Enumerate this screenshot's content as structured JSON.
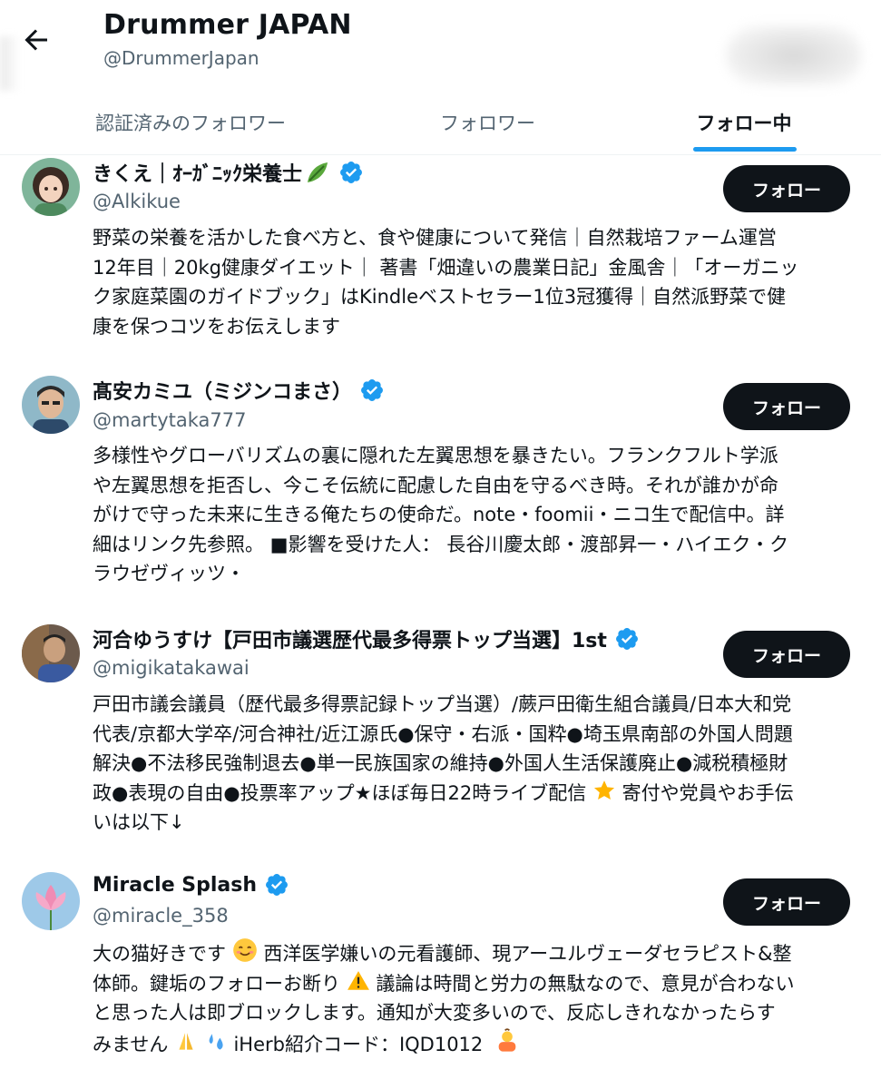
{
  "header": {
    "title": "Drummer JAPAN",
    "handle": "@DrummerJapan"
  },
  "tabs": [
    {
      "label": "認証済みのフォロワー",
      "active": false
    },
    {
      "label": "フォロワー",
      "active": false
    },
    {
      "label": "フォロー中",
      "active": true
    }
  ],
  "colors": {
    "accent": "#1d9bf0",
    "button": "#0f1419",
    "secondary_text": "#536471"
  },
  "users": [
    {
      "name": "きくえ｜ｵｰｶﾞﾆｯｸ栄養士",
      "name_emoji": "leafy-green-icon",
      "handle": "@Alkikue",
      "follow_label": "フォロー",
      "bio": [
        "野菜の栄養を活かした食べ方と、食や健康について発信｜自然栽培ファーム運営",
        "12年目｜20kg健康ダイエット｜ 著書「畑違いの農業日記」金風舎｜「オーガニッ",
        "ク家庭菜園のガイドブック」はKindleベストセラー1位3冠獲得｜自然派野菜で健",
        "康を保つコツをお伝えします"
      ]
    },
    {
      "name": "髙安カミユ（ミジンコまさ）",
      "handle": "@martytaka777",
      "follow_label": "フォロー",
      "bio": [
        "多様性やグローバリズムの裏に隠れた左翼思想を暴きたい。フランクフルト学派",
        "や左翼思想を拒否し、今こそ伝統に配慮した自由を守るべき時。それが誰かが命",
        "がけで守った未来に生きる俺たちの使命だ。note・foomii・ニコ生で配信中。詳",
        "細はリンク先参照。 ■影響を受けた人： 長谷川慶太郎・渡部昇一・ハイエク・ク",
        "ラウゼヴィッツ・"
      ]
    },
    {
      "name": "河合ゆうすけ【戸田市議選歴代最多得票トップ当選】1st",
      "handle": "@migikatakawai",
      "follow_label": "フォロー",
      "bio": [
        "戸田市議会議員（歴代最多得票記録トップ当選）/蕨戸田衛生組合議員/日本大和党",
        "代表/京都大学卒/河合神社/近江源氏●保守・右派・国粋●埼玉県南部の外国人問題",
        "解決●不法移民強制退去●単一民族国家の維持●外国人生活保護廃止●減税積極財",
        "政●表現の自由●投票率アップ★ほぼ毎日22時ライブ配信",
        "寄付や党員やお手伝",
        "いは以下↓"
      ]
    },
    {
      "name": "Miracle Splash",
      "handle": "@miracle_358",
      "follow_label": "フォロー",
      "bio": [
        "大の猫好きです",
        "西洋医学嫌いの元看護師、現アーユルヴェーダセラピスト&整",
        "体師。鍵垢のフォローお断り",
        "議論は時間と労力の無駄なので、意見が合わない",
        "と思った人は即ブロックします。通知が大変多いので、反応しきれなかったらす",
        "みません",
        "iHerb紹介コード：IQD1012"
      ]
    }
  ]
}
